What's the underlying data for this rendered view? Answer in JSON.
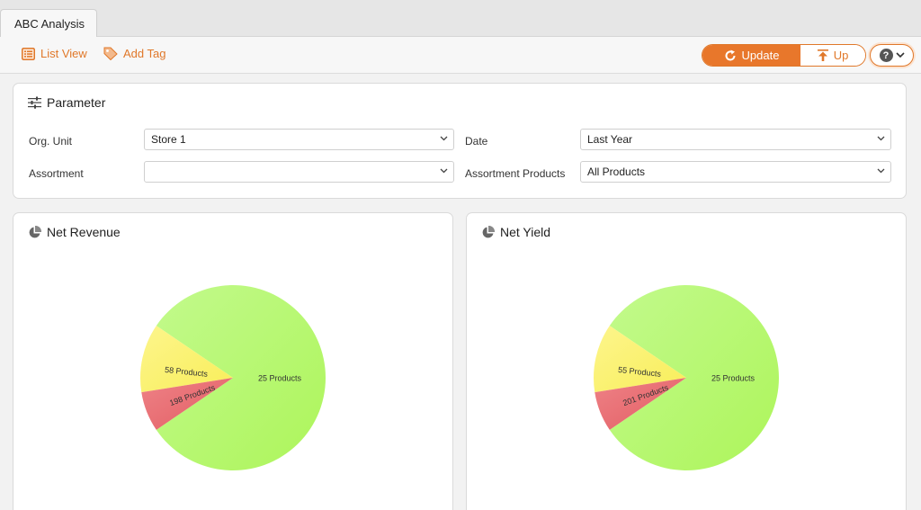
{
  "tab": {
    "title": "ABC Analysis"
  },
  "toolbar": {
    "list_view": "List View",
    "add_tag": "Add Tag",
    "update": "Update",
    "up": "Up",
    "help": "?"
  },
  "parameter": {
    "title": "Parameter",
    "org_unit": {
      "label": "Org. Unit",
      "value": "Store 1"
    },
    "date": {
      "label": "Date",
      "value": "Last Year"
    },
    "assortment": {
      "label": "Assortment",
      "value": ""
    },
    "assortment_products": {
      "label": "Assortment Products",
      "value": "All Products"
    }
  },
  "colors": {
    "accent": "#e8772b",
    "class_a": "#adf55a",
    "class_b": "#f8ee5a",
    "class_c": "#e35d62"
  },
  "chart_data": [
    {
      "type": "pie",
      "title": "Net Revenue",
      "slices": [
        {
          "label": "25 Products",
          "value": 0.81
        },
        {
          "label": "58 Products",
          "value": 0.12
        },
        {
          "label": "198 Products",
          "value": 0.07
        }
      ]
    },
    {
      "type": "pie",
      "title": "Net Yield",
      "slices": [
        {
          "label": "25 Products",
          "value": 0.81
        },
        {
          "label": "55 Products",
          "value": 0.12
        },
        {
          "label": "201 Products",
          "value": 0.07
        }
      ]
    }
  ]
}
